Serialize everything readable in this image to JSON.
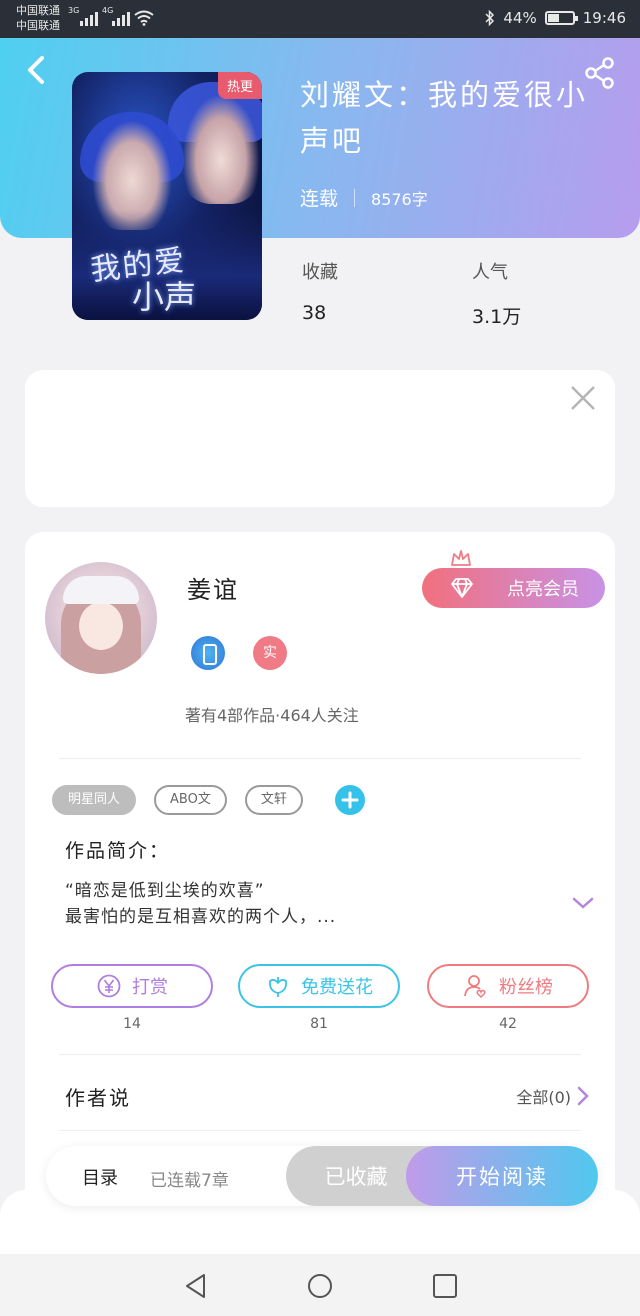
{
  "status_bar": {
    "carrier1": "中国联通",
    "carrier2": "中国联通",
    "net1": "3G",
    "net2": "4G",
    "battery": "44%",
    "time": "19:46"
  },
  "book": {
    "title": "刘耀文：我的爱很小声吧",
    "hot_badge": "热更",
    "status": "连载",
    "word_count": "8576字",
    "favorites_label": "收藏",
    "favorites_value": "38",
    "popularity_label": "人气",
    "popularity_value": "3.1万",
    "cover_text_1": "我的爱",
    "cover_text_2": "小声"
  },
  "author": {
    "name": "姜谊",
    "real_badge": "实",
    "info": "著有4部作品·464人关注",
    "vip_button": "点亮会员"
  },
  "tags": [
    "明星同人",
    "ABO文",
    "文轩"
  ],
  "intro": {
    "heading": "作品简介：",
    "line1": "“暗恋是低到尘埃的欢喜”",
    "line2": "最害怕的是互相喜欢的两个人，..."
  },
  "actions": {
    "tip_label": "打赏",
    "tip_count": "14",
    "flower_label": "免费送花",
    "flower_count": "81",
    "fans_label": "粉丝榜",
    "fans_count": "42"
  },
  "author_says": {
    "heading": "作者说",
    "all_label": "全部(0)"
  },
  "bottom_bar": {
    "toc": "目录",
    "serial": "已连载7章",
    "saved": "已收藏",
    "read": "开始阅读"
  },
  "colors": {
    "header_start": "#4fd0f0",
    "header_end": "#b69ded",
    "tip": "#b07ee0",
    "flower": "#3cc4e6",
    "fans": "#ef7b80"
  },
  "icons": [
    "back-arrow-icon",
    "share-icon",
    "close-icon",
    "diamond-icon",
    "crown-icon",
    "plus-icon",
    "chevron-down-icon",
    "yen-icon",
    "flower-icon",
    "fan-icon",
    "chevron-right-icon",
    "nav-back-icon",
    "nav-home-icon",
    "nav-recents-icon"
  ]
}
